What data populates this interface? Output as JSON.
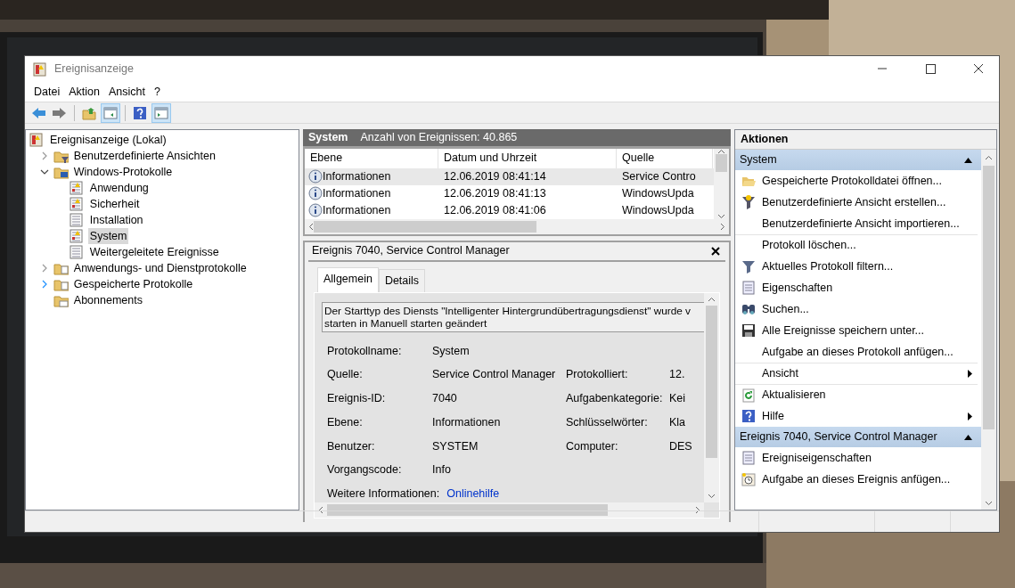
{
  "window": {
    "title": "Ereignisanzeige"
  },
  "menu": [
    "Datei",
    "Aktion",
    "Ansicht",
    "?"
  ],
  "toolbar": [
    {
      "kind": "back",
      "pressed": false
    },
    {
      "kind": "forward",
      "pressed": false
    },
    {
      "kind": "separator"
    },
    {
      "kind": "up",
      "pressed": false
    },
    {
      "kind": "tree",
      "pressed": true
    },
    {
      "kind": "separator"
    },
    {
      "kind": "help",
      "pressed": false
    },
    {
      "kind": "pane",
      "pressed": true
    }
  ],
  "tree": [
    {
      "label": "Ereignisanzeige (Lokal)",
      "kind": "root",
      "selected": false,
      "children": [
        {
          "label": "Benutzerdefinierte Ansichten",
          "kind": "filterfolder",
          "selected": false,
          "expanded": false,
          "hover": false
        },
        {
          "label": "Windows-Protokolle",
          "kind": "pcfolder",
          "selected": false,
          "expanded": true,
          "hover": false,
          "children": [
            {
              "label": "Anwendung",
              "kind": "log",
              "selected": false
            },
            {
              "label": "Sicherheit",
              "kind": "log",
              "selected": false
            },
            {
              "label": "Installation",
              "kind": "plainlog",
              "selected": false
            },
            {
              "label": "System",
              "kind": "log",
              "selected": true
            },
            {
              "label": "Weitergeleitete Ereignisse",
              "kind": "plainlog",
              "selected": false
            }
          ]
        },
        {
          "label": "Anwendungs- und Dienstprotokolle",
          "kind": "folder",
          "selected": false,
          "expanded": false,
          "hover": false
        },
        {
          "label": "Gespeicherte Protokolle",
          "kind": "folder",
          "selected": false,
          "expanded": false,
          "hover": true
        },
        {
          "label": "Abonnements",
          "kind": "subfolder",
          "selected": false
        }
      ]
    }
  ],
  "log_header": {
    "title": "System",
    "count": "Anzahl von Ereignissen: 40.865"
  },
  "events": {
    "columns": [
      "Ebene",
      "Datum und Uhrzeit",
      "Quelle"
    ],
    "rows": [
      {
        "level": "Informationen",
        "date": "12.06.2019 08:41:14",
        "source": "Service Contro",
        "selected": true
      },
      {
        "level": "Informationen",
        "date": "12.06.2019 08:41:13",
        "source": "WindowsUpda",
        "selected": false
      },
      {
        "level": "Informationen",
        "date": "12.06.2019 08:41:06",
        "source": "WindowsUpda",
        "selected": false
      }
    ]
  },
  "event_detail": {
    "title": "Ereignis 7040, Service Control Manager",
    "tabs": [
      {
        "label": "Allgemein",
        "selected": true
      },
      {
        "label": "Details",
        "selected": false
      }
    ],
    "message": "Der Starttyp des Diensts \"Intelligenter Hintergrundübertragungsdienst\" wurde v",
    "message_line_2": "starten in Manuell starten geändert",
    "fields": [
      {
        "label": "Protokollname:",
        "value": "System"
      },
      {
        "label": "Quelle:",
        "value": "Service Control Manager",
        "label_2": "Protokolliert:",
        "value_2": "12."
      },
      {
        "label": "Ereignis-ID:",
        "value": "7040",
        "label_2": "Aufgabenkategorie:",
        "value_2": "Kei"
      },
      {
        "label": "Ebene:",
        "value": "Informationen",
        "label_2": "Schlüsselwörter:",
        "value_2": "Kla"
      },
      {
        "label": "Benutzer:",
        "value": "SYSTEM",
        "label_2": "Computer:",
        "value_2": "DES"
      },
      {
        "label": "Vorgangscode:",
        "value": "Info"
      }
    ],
    "more_info": {
      "label": "Weitere Informationen:",
      "link": "Onlinehilfe"
    }
  },
  "actions": {
    "title": "Aktionen",
    "sections": [
      {
        "title": "System",
        "expanded": true,
        "items": [
          {
            "label": "Gespeicherte Protokolldatei öffnen...",
            "submenu": false,
            "separator_before": false
          },
          {
            "label": "Benutzerdefinierte Ansicht erstellen...",
            "submenu": false,
            "separator_before": false
          },
          {
            "label": "Benutzerdefinierte Ansicht importieren...",
            "submenu": false,
            "separator_before": false
          },
          {
            "label": "Protokoll löschen...",
            "submenu": false,
            "separator_before": true
          },
          {
            "label": "Aktuelles Protokoll filtern...",
            "submenu": false,
            "separator_before": false
          },
          {
            "label": "Eigenschaften",
            "submenu": false,
            "separator_before": false
          },
          {
            "label": "Suchen...",
            "submenu": false,
            "separator_before": false
          },
          {
            "label": "Alle Ereignisse speichern unter...",
            "submenu": false,
            "separator_before": false
          },
          {
            "label": "Aufgabe an dieses Protokoll anfügen...",
            "submenu": false,
            "separator_before": false
          },
          {
            "label": "Ansicht",
            "submenu": true,
            "separator_before": true
          },
          {
            "label": "Aktualisieren",
            "submenu": false,
            "separator_before": true
          },
          {
            "label": "Hilfe",
            "submenu": true,
            "separator_before": false
          }
        ]
      },
      {
        "title": "Ereignis 7040, Service Control Manager",
        "expanded": true,
        "items": [
          {
            "label": "Ereigniseigenschaften",
            "submenu": false,
            "separator_before": false
          },
          {
            "label": "Aufgabe an dieses Ereignis anfügen...",
            "submenu": false,
            "separator_before": false
          }
        ]
      }
    ]
  }
}
